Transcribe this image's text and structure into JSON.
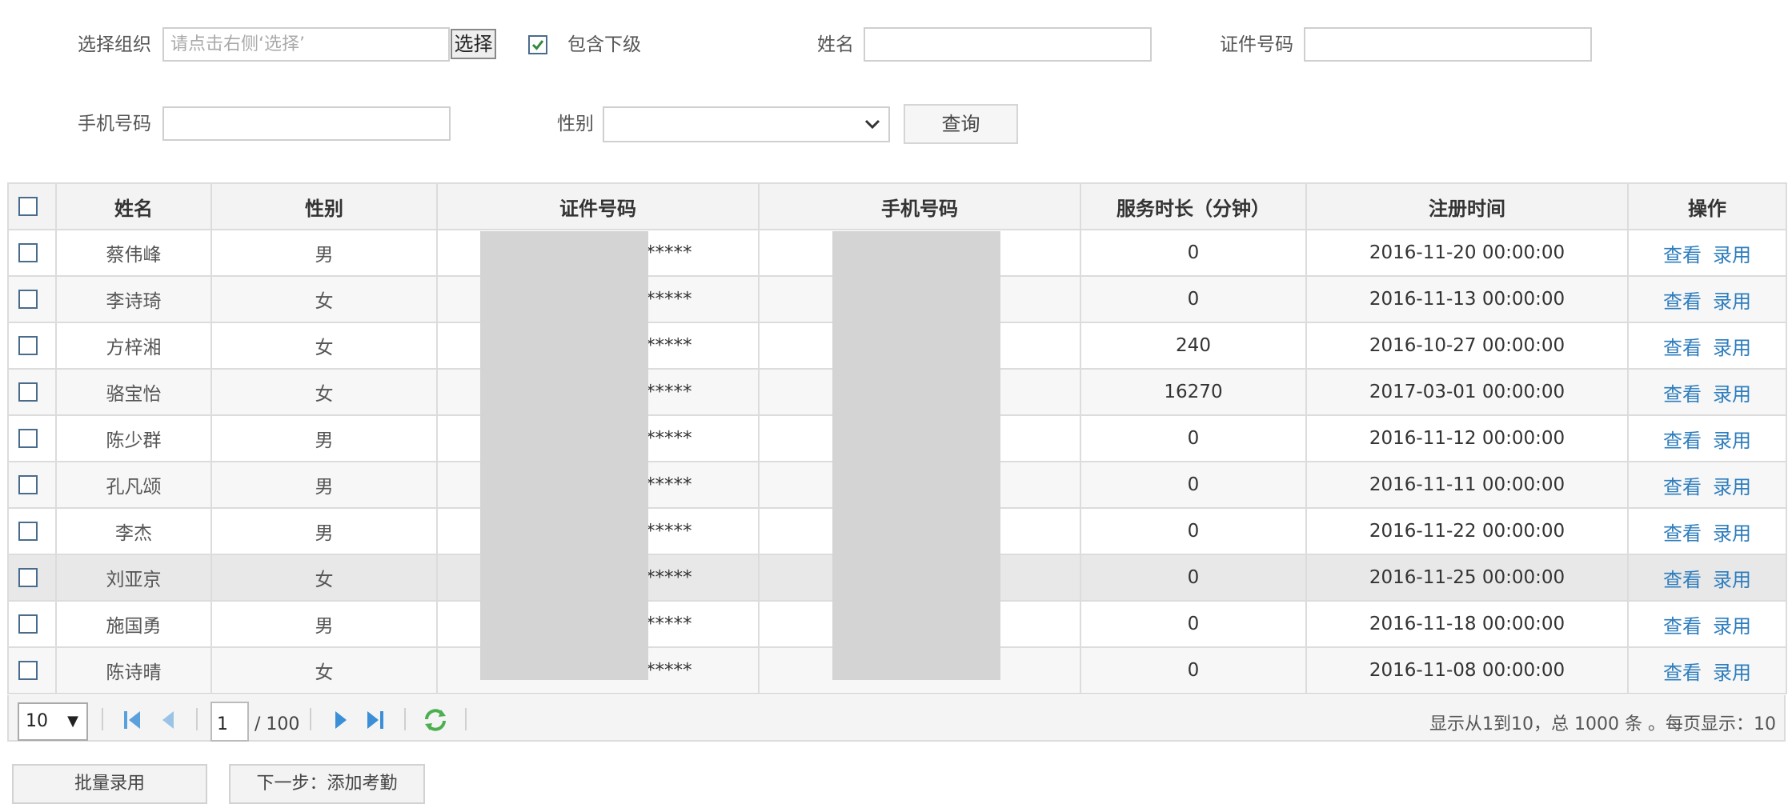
{
  "filters": {
    "org_label": "选择组织",
    "org_placeholder": "请点击右侧‘选择’",
    "choose_button": "选择",
    "include_sub_label": "包含下级",
    "name_label": "姓名",
    "id_label": "证件号码",
    "phone_label": "手机号码",
    "gender_label": "性别",
    "gender_selected": "",
    "query_button": "查询"
  },
  "table": {
    "headers": [
      "姓名",
      "性别",
      "证件号码",
      "手机号码",
      "服务时长（分钟）",
      "注册时间",
      "操作"
    ],
    "rows": [
      {
        "name": "蔡伟峰",
        "gender": "男",
        "id": "*****",
        "phone": "",
        "duration": "0",
        "registered": "2016-11-20 00:00:00"
      },
      {
        "name": "李诗琦",
        "gender": "女",
        "id": "*****",
        "phone": "",
        "duration": "0",
        "registered": "2016-11-13 00:00:00"
      },
      {
        "name": "方梓湘",
        "gender": "女",
        "id": "*****",
        "phone": "",
        "duration": "240",
        "registered": "2016-10-27 00:00:00"
      },
      {
        "name": "骆宝怡",
        "gender": "女",
        "id": "*****",
        "phone": "",
        "duration": "16270",
        "registered": "2017-03-01 00:00:00"
      },
      {
        "name": "陈少群",
        "gender": "男",
        "id": "*****",
        "phone": "",
        "duration": "0",
        "registered": "2016-11-12 00:00:00"
      },
      {
        "name": "孔凡颂",
        "gender": "男",
        "id": "*****",
        "phone": "",
        "duration": "0",
        "registered": "2016-11-11 00:00:00"
      },
      {
        "name": "李杰",
        "gender": "男",
        "id": "*****",
        "phone": "",
        "duration": "0",
        "registered": "2016-11-22 00:00:00"
      },
      {
        "name": "刘亚京",
        "gender": "女",
        "id": "*****",
        "phone": "",
        "duration": "0",
        "registered": "2016-11-25 00:00:00"
      },
      {
        "name": "施国勇",
        "gender": "男",
        "id": "*****",
        "phone": "",
        "duration": "0",
        "registered": "2016-11-18 00:00:00"
      },
      {
        "name": "陈诗晴",
        "gender": "女",
        "id": "*****",
        "phone": "",
        "duration": "0",
        "registered": "2016-11-08 00:00:00"
      }
    ],
    "action_view": "查看",
    "action_hire": "录用"
  },
  "pager": {
    "page_size": "10",
    "current_page": "1",
    "total_pages": "/ 100",
    "info": "显示从1到10，总 1000 条 。每页显示：10"
  },
  "buttons": {
    "batch_hire": "批量录用",
    "next_step": "下一步：添加考勤"
  },
  "colors": {
    "link": "#2d7dbd",
    "checkbox_border": "#4a6c8c",
    "check_mark": "#2e8b3e",
    "pager_icon": "#3a8fd6",
    "refresh_icon": "#4caf50"
  }
}
